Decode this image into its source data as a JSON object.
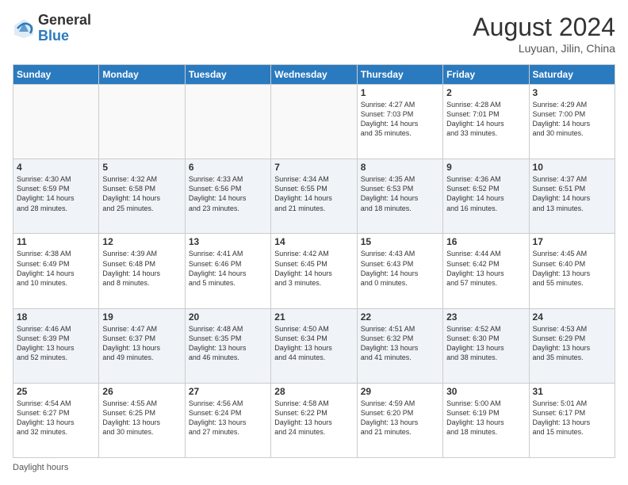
{
  "header": {
    "logo_general": "General",
    "logo_blue": "Blue",
    "month_year": "August 2024",
    "location": "Luyuan, Jilin, China"
  },
  "footer": {
    "daylight_label": "Daylight hours"
  },
  "days_of_week": [
    "Sunday",
    "Monday",
    "Tuesday",
    "Wednesday",
    "Thursday",
    "Friday",
    "Saturday"
  ],
  "weeks": [
    [
      {
        "num": "",
        "info": ""
      },
      {
        "num": "",
        "info": ""
      },
      {
        "num": "",
        "info": ""
      },
      {
        "num": "",
        "info": ""
      },
      {
        "num": "1",
        "info": "Sunrise: 4:27 AM\nSunset: 7:03 PM\nDaylight: 14 hours\nand 35 minutes."
      },
      {
        "num": "2",
        "info": "Sunrise: 4:28 AM\nSunset: 7:01 PM\nDaylight: 14 hours\nand 33 minutes."
      },
      {
        "num": "3",
        "info": "Sunrise: 4:29 AM\nSunset: 7:00 PM\nDaylight: 14 hours\nand 30 minutes."
      }
    ],
    [
      {
        "num": "4",
        "info": "Sunrise: 4:30 AM\nSunset: 6:59 PM\nDaylight: 14 hours\nand 28 minutes."
      },
      {
        "num": "5",
        "info": "Sunrise: 4:32 AM\nSunset: 6:58 PM\nDaylight: 14 hours\nand 25 minutes."
      },
      {
        "num": "6",
        "info": "Sunrise: 4:33 AM\nSunset: 6:56 PM\nDaylight: 14 hours\nand 23 minutes."
      },
      {
        "num": "7",
        "info": "Sunrise: 4:34 AM\nSunset: 6:55 PM\nDaylight: 14 hours\nand 21 minutes."
      },
      {
        "num": "8",
        "info": "Sunrise: 4:35 AM\nSunset: 6:53 PM\nDaylight: 14 hours\nand 18 minutes."
      },
      {
        "num": "9",
        "info": "Sunrise: 4:36 AM\nSunset: 6:52 PM\nDaylight: 14 hours\nand 16 minutes."
      },
      {
        "num": "10",
        "info": "Sunrise: 4:37 AM\nSunset: 6:51 PM\nDaylight: 14 hours\nand 13 minutes."
      }
    ],
    [
      {
        "num": "11",
        "info": "Sunrise: 4:38 AM\nSunset: 6:49 PM\nDaylight: 14 hours\nand 10 minutes."
      },
      {
        "num": "12",
        "info": "Sunrise: 4:39 AM\nSunset: 6:48 PM\nDaylight: 14 hours\nand 8 minutes."
      },
      {
        "num": "13",
        "info": "Sunrise: 4:41 AM\nSunset: 6:46 PM\nDaylight: 14 hours\nand 5 minutes."
      },
      {
        "num": "14",
        "info": "Sunrise: 4:42 AM\nSunset: 6:45 PM\nDaylight: 14 hours\nand 3 minutes."
      },
      {
        "num": "15",
        "info": "Sunrise: 4:43 AM\nSunset: 6:43 PM\nDaylight: 14 hours\nand 0 minutes."
      },
      {
        "num": "16",
        "info": "Sunrise: 4:44 AM\nSunset: 6:42 PM\nDaylight: 13 hours\nand 57 minutes."
      },
      {
        "num": "17",
        "info": "Sunrise: 4:45 AM\nSunset: 6:40 PM\nDaylight: 13 hours\nand 55 minutes."
      }
    ],
    [
      {
        "num": "18",
        "info": "Sunrise: 4:46 AM\nSunset: 6:39 PM\nDaylight: 13 hours\nand 52 minutes."
      },
      {
        "num": "19",
        "info": "Sunrise: 4:47 AM\nSunset: 6:37 PM\nDaylight: 13 hours\nand 49 minutes."
      },
      {
        "num": "20",
        "info": "Sunrise: 4:48 AM\nSunset: 6:35 PM\nDaylight: 13 hours\nand 46 minutes."
      },
      {
        "num": "21",
        "info": "Sunrise: 4:50 AM\nSunset: 6:34 PM\nDaylight: 13 hours\nand 44 minutes."
      },
      {
        "num": "22",
        "info": "Sunrise: 4:51 AM\nSunset: 6:32 PM\nDaylight: 13 hours\nand 41 minutes."
      },
      {
        "num": "23",
        "info": "Sunrise: 4:52 AM\nSunset: 6:30 PM\nDaylight: 13 hours\nand 38 minutes."
      },
      {
        "num": "24",
        "info": "Sunrise: 4:53 AM\nSunset: 6:29 PM\nDaylight: 13 hours\nand 35 minutes."
      }
    ],
    [
      {
        "num": "25",
        "info": "Sunrise: 4:54 AM\nSunset: 6:27 PM\nDaylight: 13 hours\nand 32 minutes."
      },
      {
        "num": "26",
        "info": "Sunrise: 4:55 AM\nSunset: 6:25 PM\nDaylight: 13 hours\nand 30 minutes."
      },
      {
        "num": "27",
        "info": "Sunrise: 4:56 AM\nSunset: 6:24 PM\nDaylight: 13 hours\nand 27 minutes."
      },
      {
        "num": "28",
        "info": "Sunrise: 4:58 AM\nSunset: 6:22 PM\nDaylight: 13 hours\nand 24 minutes."
      },
      {
        "num": "29",
        "info": "Sunrise: 4:59 AM\nSunset: 6:20 PM\nDaylight: 13 hours\nand 21 minutes."
      },
      {
        "num": "30",
        "info": "Sunrise: 5:00 AM\nSunset: 6:19 PM\nDaylight: 13 hours\nand 18 minutes."
      },
      {
        "num": "31",
        "info": "Sunrise: 5:01 AM\nSunset: 6:17 PM\nDaylight: 13 hours\nand 15 minutes."
      }
    ]
  ]
}
